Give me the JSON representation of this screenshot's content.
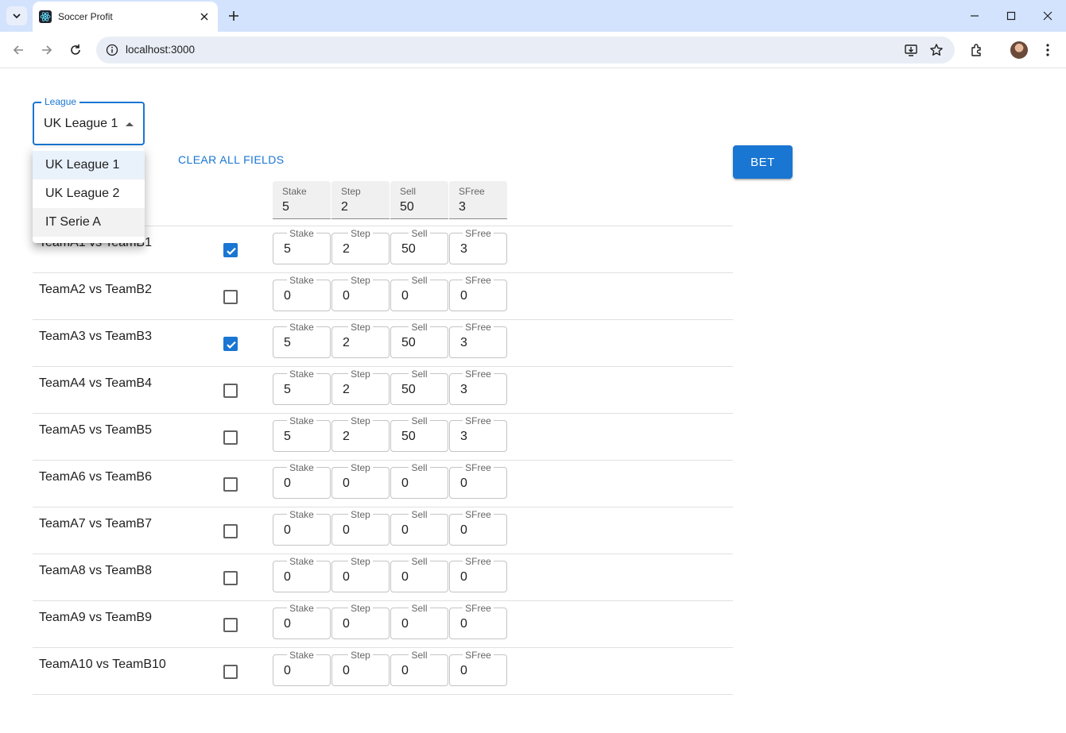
{
  "browser": {
    "tab_title": "Soccer Profit",
    "url": "localhost:3000"
  },
  "league": {
    "label": "League",
    "selected": "UK League 1",
    "options": [
      "UK League 1",
      "UK League 2",
      "IT Serie A"
    ]
  },
  "actions": {
    "clear_label": "CLEAR ALL FIELDS",
    "bet_label": "BET"
  },
  "master_fields": [
    {
      "label": "Stake",
      "value": "5"
    },
    {
      "label": "Step",
      "value": "2"
    },
    {
      "label": "Sell",
      "value": "50"
    },
    {
      "label": "SFree",
      "value": "3"
    }
  ],
  "field_labels": [
    "Stake",
    "Step",
    "Sell",
    "SFree"
  ],
  "matches": [
    {
      "name": "TeamA1 vs TeamB1",
      "checked": true,
      "values": [
        "5",
        "2",
        "50",
        "3"
      ]
    },
    {
      "name": "TeamA2 vs TeamB2",
      "checked": false,
      "values": [
        "0",
        "0",
        "0",
        "0"
      ]
    },
    {
      "name": "TeamA3 vs TeamB3",
      "checked": true,
      "values": [
        "5",
        "2",
        "50",
        "3"
      ]
    },
    {
      "name": "TeamA4 vs TeamB4",
      "checked": false,
      "values": [
        "5",
        "2",
        "50",
        "3"
      ]
    },
    {
      "name": "TeamA5 vs TeamB5",
      "checked": false,
      "values": [
        "5",
        "2",
        "50",
        "3"
      ]
    },
    {
      "name": "TeamA6 vs TeamB6",
      "checked": false,
      "values": [
        "0",
        "0",
        "0",
        "0"
      ]
    },
    {
      "name": "TeamA7 vs TeamB7",
      "checked": false,
      "values": [
        "0",
        "0",
        "0",
        "0"
      ]
    },
    {
      "name": "TeamA8 vs TeamB8",
      "checked": false,
      "values": [
        "0",
        "0",
        "0",
        "0"
      ]
    },
    {
      "name": "TeamA9 vs TeamB9",
      "checked": false,
      "values": [
        "0",
        "0",
        "0",
        "0"
      ]
    },
    {
      "name": "TeamA10 vs TeamB10",
      "checked": false,
      "values": [
        "0",
        "0",
        "0",
        "0"
      ]
    }
  ],
  "colors": {
    "primary": "#1976d2",
    "tabstrip": "#d3e3fd"
  }
}
